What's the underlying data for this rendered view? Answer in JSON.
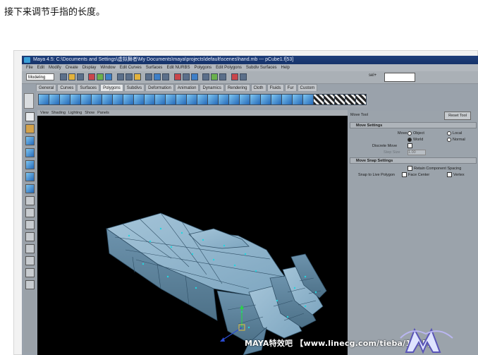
{
  "caption": "接下来调节手指的长度。",
  "window_title": "Maya 4.5: C:\\Documents and Settings\\虚拟舞者\\My Documents\\maya\\projects\\default\\scenes\\hand.mb  ---  pCube1.f[53]",
  "menubar": [
    "File",
    "Edit",
    "Modify",
    "Create",
    "Display",
    "Window",
    "Edit Curves",
    "Surfaces",
    "Edit NURBS",
    "Polygons",
    "Edit Polygons",
    "Subdiv Surfaces",
    "Help"
  ],
  "mode_menu": "Modeling",
  "select_field_label": "sel+",
  "shelf_tabs": [
    "General",
    "Curves",
    "Surfaces",
    "Polygons",
    "Subdivs",
    "Deformation",
    "Animation",
    "Dynamics",
    "Rendering",
    "Cloth",
    "Fluids",
    "Fur",
    "Custom"
  ],
  "active_shelf_tab": "Polygons",
  "panel_menu": [
    "View",
    "Shading",
    "Lighting",
    "Show",
    "Panels"
  ],
  "tool_settings": {
    "title": "Move Tool",
    "reset_button": "Reset Tool",
    "move_settings": {
      "header": "Move Settings",
      "move_label": "Move",
      "options": [
        "Object",
        "Local",
        "World",
        "Normal"
      ],
      "selected": "World",
      "discrete_move": "Discrete Move",
      "discrete_value_label": "Step Size",
      "discrete_value": "1.00"
    },
    "move_snap_settings": {
      "header": "Move Snap Settings",
      "retain_spacing": "Retain Component Spacing",
      "snap_label": "Snap to Live Polygon",
      "face_center": "Face Center",
      "vertex": "Vertex"
    }
  },
  "watermark": "MAYA特效吧 【www.linecg.com/tieba/1745】",
  "colors": {
    "viewport_bg": "#000000",
    "mesh_face": "#8fb4cc",
    "mesh_edge": "#2f4f66",
    "vertex": "#23d6e0",
    "ui_gray": "#9ba3ab",
    "titlebar": "#1f3f7a"
  }
}
